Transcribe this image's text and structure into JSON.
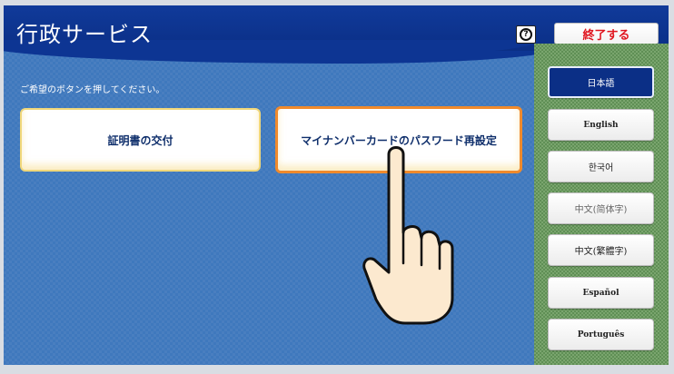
{
  "header": {
    "title": "行政サービス",
    "help_label": "?",
    "end_label": "終了する"
  },
  "main": {
    "instruction": "ご希望のボタンを押してください。",
    "services": [
      {
        "label": "証明書の交付"
      },
      {
        "label": "マイナンバーカードのパスワード再設定"
      }
    ]
  },
  "languages": [
    {
      "label": "日本語",
      "selected": true
    },
    {
      "label": "English"
    },
    {
      "label": "한국어"
    },
    {
      "label": "中文(简体字)"
    },
    {
      "label": "中文(繁體字)"
    },
    {
      "label": "Español"
    },
    {
      "label": "Português"
    }
  ],
  "colors": {
    "header": "#0b2f86",
    "main_bg": "#3f78bd",
    "side_bg": "#7aa56e",
    "end_text": "#e0141e",
    "highlight_border": "#f08a2c"
  },
  "icons": {
    "help": "help-icon",
    "pointer": "hand-pointer-icon"
  }
}
